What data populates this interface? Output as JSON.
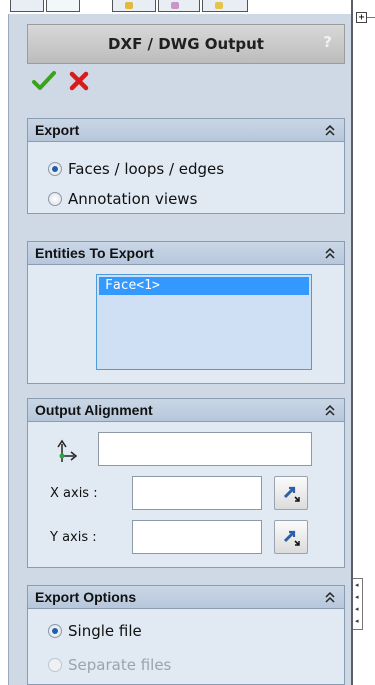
{
  "header": {
    "title": "DXF / DWG Output",
    "help_label": "?"
  },
  "actions": {
    "ok_icon": "check-icon",
    "cancel_icon": "x-icon",
    "ok_color": "#3aa31a",
    "cancel_color": "#d81b1b"
  },
  "export": {
    "title": "Export",
    "options": [
      {
        "label": "Faces / loops / edges",
        "selected": true
      },
      {
        "label": "Annotation views",
        "selected": false
      }
    ]
  },
  "entities": {
    "title": "Entities To Export",
    "items": [
      "Face<1>"
    ]
  },
  "alignment": {
    "title": "Output Alignment",
    "origin_value": "",
    "x_axis_label": "X axis :",
    "x_axis_value": "",
    "y_axis_label": "Y axis :",
    "y_axis_value": ""
  },
  "export_options": {
    "title": "Export Options",
    "options": [
      {
        "label": "Single file",
        "selected": true
      },
      {
        "label": "Separate files",
        "selected": false,
        "disabled": true
      }
    ]
  },
  "colors": {
    "accent": "#3399ff",
    "group_bg": "#e1e9f3",
    "header_bg": "#c9c9c9"
  }
}
